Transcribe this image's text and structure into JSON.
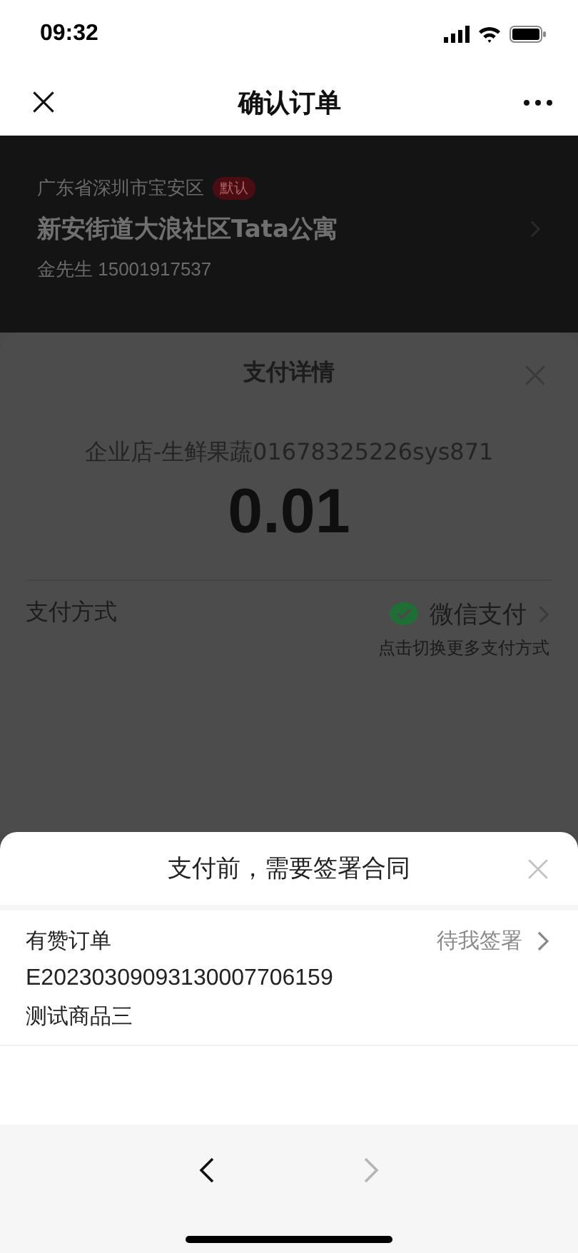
{
  "status_bar": {
    "time": "09:32"
  },
  "nav_bar": {
    "title": "确认订单"
  },
  "address": {
    "region": "广东省深圳市宝安区",
    "tag": "默认",
    "street": "新安街道大浪社区Tata公寓",
    "contact": "金先生 15001917537"
  },
  "payment_sheet": {
    "title": "支付详情",
    "merchant": "企业店-生鲜果蔬01678325226sys871",
    "amount": "0.01",
    "method_label": "支付方式",
    "method_name": "微信支付",
    "method_hint": "点击切换更多支付方式"
  },
  "contract_sheet": {
    "title": "支付前，需要签署合同",
    "order": {
      "shop": "有赞订单",
      "status": "待我签署",
      "number": "E20230309093130007706159",
      "product": "测试商品三"
    }
  },
  "browser_nav": {
    "back_disabled": false,
    "forward_disabled": true
  }
}
